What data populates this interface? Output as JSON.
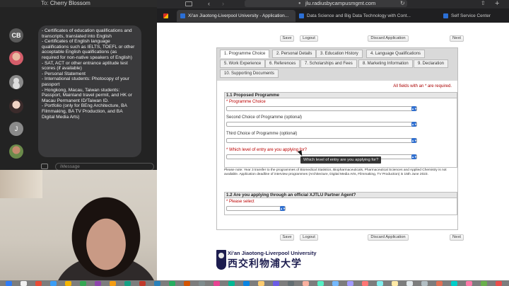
{
  "messages": {
    "to_label": "To:",
    "recipient": "Cherry Blossom",
    "current_contact_initials": "CB",
    "contact_initial_j": "J",
    "input_placeholder": "iMessage",
    "bubble_lines": [
      "- Certificates of education qualifications and",
      "transcripts, translated into English",
      "",
      "- Certificates of English language",
      "qualifications such as IELTS, TOEFL or other",
      "acceptable English qualifications (as",
      "required for non-native speakers of English)",
      "",
      "- SAT, ACT or other entrance aptitude test",
      "scores (if available)",
      "- Personal Statement",
      "",
      "- International students: Photocopy of your",
      "passport",
      "",
      "- Hongkong, Macau, Taiwan students:",
      "Passport, Mainland travel permit, and HK or",
      "Macau Permanent ID/Taiwan ID.",
      "",
      "- Portfolio (only for BEng Architecture, BA",
      "Filmmaking, BA TV Production, and BA",
      "Digital Media Arts)"
    ]
  },
  "browser": {
    "url": "jlu.radiusbycampusmgmt.com",
    "tabs": [
      {
        "label": "",
        "icon": "gmail-icon"
      },
      {
        "label": "Xi'an Jiaotong-Liverpool University - Application...",
        "active": true
      },
      {
        "label": "Data Science and Big Data Technology with Cont..."
      },
      {
        "label": "Self Service Center"
      }
    ]
  },
  "form": {
    "buttons": {
      "save": "Save",
      "logout": "Logout",
      "discard": "Discard Application",
      "next": "Next"
    },
    "tabs": [
      "1. Programme Choice",
      "2. Personal Details",
      "3. Education History",
      "4. Language Qualifications",
      "5. Work Experience",
      "6. References",
      "7. Scholarships and Fees",
      "8. Marketing Information",
      "9. Declaration",
      "10. Supporting Documents"
    ],
    "required_note": "All fields with an * are required.",
    "section1_title": "1.1 Proposed Programme",
    "field_programme_choice": "* Programme Choice",
    "field_second_choice": "Second Choice of Programme (optional)",
    "field_third_choice": "Third Choice of Programme (optional)",
    "field_entry_level": "* Which level of entry are you applying for?",
    "tooltip": "Which level of entry are you applying for?",
    "note_line1": "Please note: Year 3 transfer to the programmes of Biomedical Statistics, Biopharmaceuticals, Pharmaceutical Sciences and Applied Chemistry is not",
    "note_line2": "available. Application deadline of interview programmes (Architecture, Digital Media Arts, Filmmaking, TV Production) is 15th June 2023.",
    "section2_title": "1.2 Are you applying through an official XJTLU Partner Agent?",
    "field_please_select": "* Please select"
  },
  "logo": {
    "english": "Xi'an Jiaotong-Liverpool University",
    "chinese": "西交利物浦大学"
  },
  "colors": {
    "required_red": "#b00000",
    "select_blue": "#2f6fd0",
    "xjtlu_navy": "#1d1d4f"
  }
}
